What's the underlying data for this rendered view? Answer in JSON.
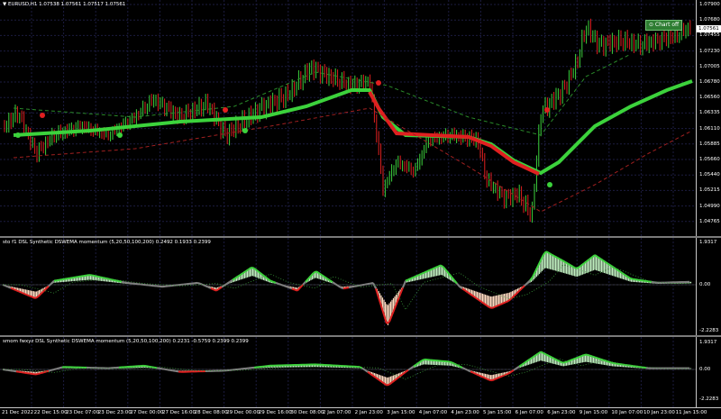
{
  "main": {
    "title": "▼ EURUSD,H1  1.07538  1.07561  1.07517  1.07561",
    "button": "⊙ Chart off",
    "current_price": "1.07561",
    "price_labels": [
      "1.07900",
      "1.07680",
      "1.07455",
      "1.07230",
      "1.07005",
      "1.06780",
      "1.06560",
      "1.06335",
      "1.06110",
      "1.05885",
      "1.05660",
      "1.05440",
      "1.05215",
      "1.04990",
      "1.04765"
    ]
  },
  "ind1": {
    "title": "sto f1 DSL Synthetic DSWEMA momentum (5,20,50,100,200) 0.2492 0.1933 0.2399",
    "labels": [
      "1.9317",
      "0.00",
      "-2.2283"
    ]
  },
  "ind2": {
    "title": "smom fwxyz DSL Synthetic DSWEMA momentum (5,20,50,100,200) 0.2231 -0.5759 0.2399 0.2399",
    "labels": [
      "1.9317",
      "0.00",
      "-2.2283"
    ]
  },
  "time_labels": [
    "21 Dec 2022",
    "22 Dec 15:00",
    "23 Dec 07:00",
    "23 Dec 23:00",
    "27 Dec 00:00",
    "27 Dec 16:00",
    "28 Dec 08:00",
    "29 Dec 00:00",
    "29 Dec 16:00",
    "30 Dec 08:00",
    "2 Jan 07:00",
    "2 Jan 23:00",
    "3 Jan 15:00",
    "4 Jan 07:00",
    "4 Jan 23:00",
    "5 Jan 15:00",
    "6 Jan 07:00",
    "6 Jan 23:00",
    "9 Jan 15:00",
    "10 Jan 07:00",
    "10 Jan 23:00",
    "11 Jan 15:00"
  ],
  "colors": {
    "bull": "#3cd23c",
    "bear": "#e02020",
    "grid": "#1c1c40",
    "neutral": "#808080"
  }
}
